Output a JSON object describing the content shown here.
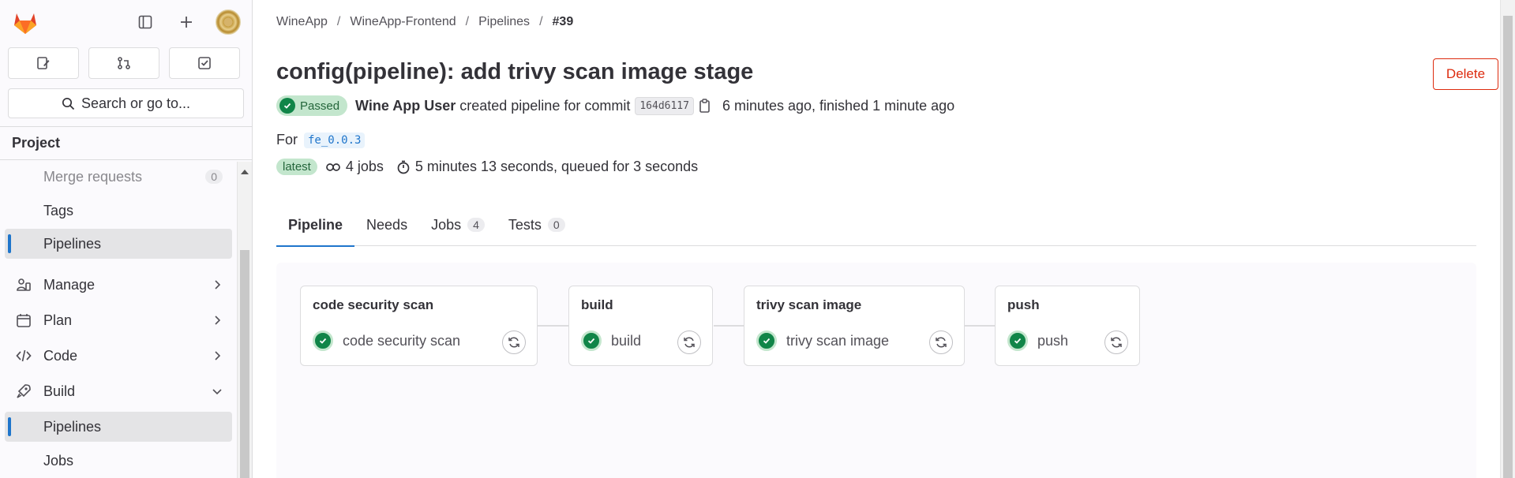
{
  "sidebar": {
    "search_label": "Search or go to...",
    "section_title": "Project",
    "items": [
      {
        "label": "Merge requests",
        "count": "0"
      },
      {
        "label": "Tags"
      },
      {
        "label": "Pipelines"
      },
      {
        "label": "Manage"
      },
      {
        "label": "Plan"
      },
      {
        "label": "Code"
      },
      {
        "label": "Build"
      },
      {
        "label": "Pipelines"
      },
      {
        "label": "Jobs"
      }
    ]
  },
  "breadcrumb": [
    "WineApp",
    "WineApp-Frontend",
    "Pipelines",
    "#39"
  ],
  "header": {
    "title": "config(pipeline): add trivy scan image stage",
    "delete_label": "Delete",
    "status": "Passed",
    "user": "Wine App User",
    "created_text": "created pipeline for commit",
    "commit": "164d6117",
    "time_text": "6 minutes ago, finished 1 minute ago",
    "for_label": "For",
    "ref": "fe_0.0.3",
    "latest": "latest",
    "jobs_text": "4 jobs",
    "duration_text": "5 minutes 13 seconds, queued for 3 seconds"
  },
  "tabs": [
    {
      "label": "Pipeline"
    },
    {
      "label": "Needs"
    },
    {
      "label": "Jobs",
      "count": "4"
    },
    {
      "label": "Tests",
      "count": "0"
    }
  ],
  "stages": [
    {
      "title": "code security scan",
      "job": "code security scan"
    },
    {
      "title": "build",
      "job": "build"
    },
    {
      "title": "trivy scan image",
      "job": "trivy scan image"
    },
    {
      "title": "push",
      "job": "push"
    }
  ],
  "colors": {
    "accent": "#1f75cb",
    "success": "#108548",
    "danger": "#dd2b0e"
  }
}
